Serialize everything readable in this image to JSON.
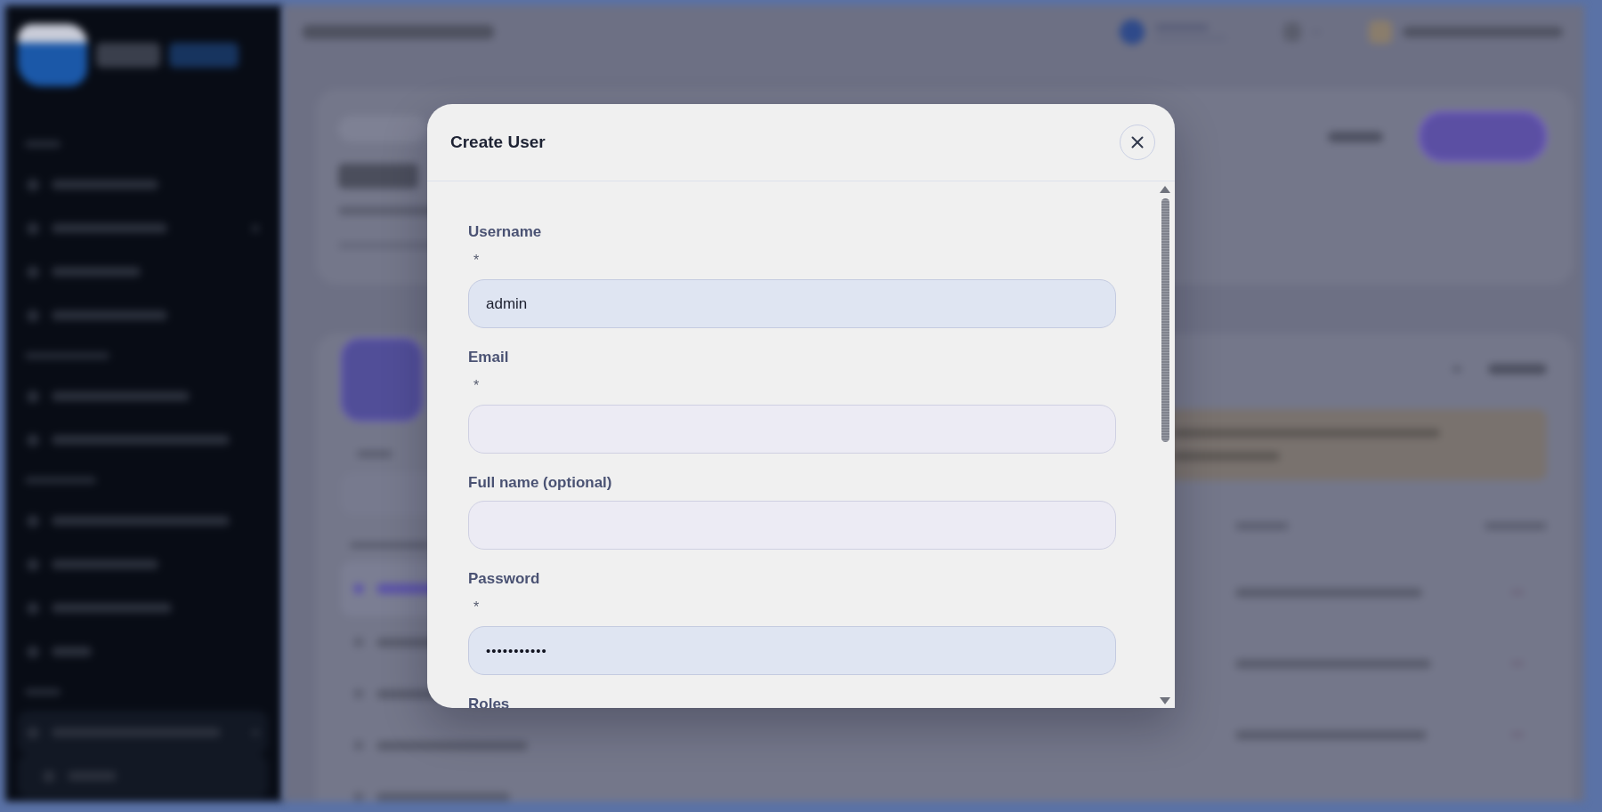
{
  "dialog": {
    "title": "Create User"
  },
  "fields": [
    {
      "kind": "text",
      "label": "Username",
      "required_mark": "*",
      "value": "admin"
    },
    {
      "kind": "text",
      "label": "Email",
      "required_mark": "*"
    },
    {
      "kind": "text",
      "label": "Full name (optional)"
    },
    {
      "kind": "password",
      "label": "Password",
      "required_mark": "*",
      "value": "•••••••••••"
    },
    {
      "kind": "label",
      "label": "Roles"
    }
  ]
}
